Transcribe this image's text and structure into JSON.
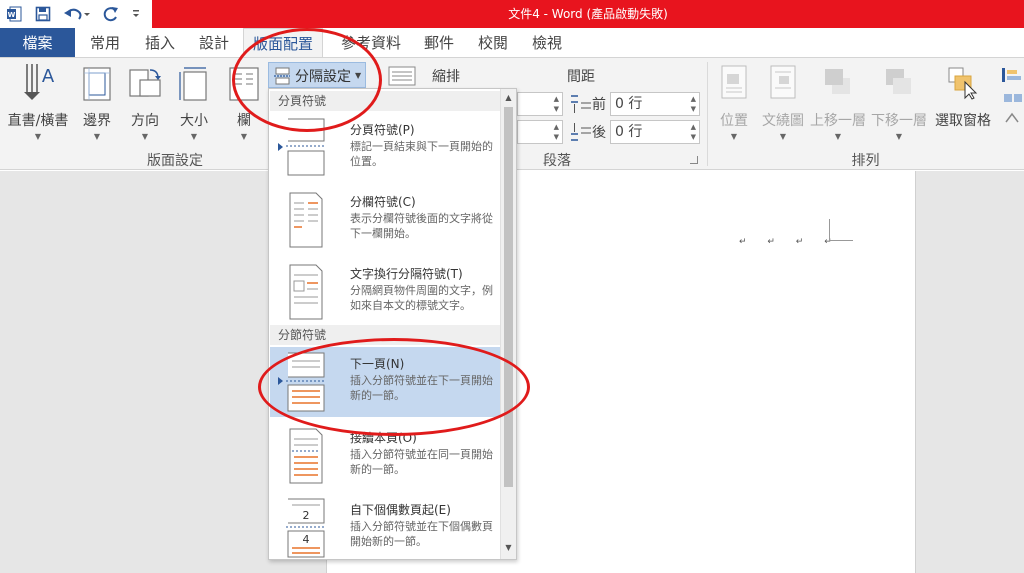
{
  "window": {
    "title": "文件4 - Word (產品啟動失敗)",
    "title_bar_color": "#e8141e",
    "accent_color": "#2b579a"
  },
  "quick_access": {
    "icons": [
      "word-logo-icon",
      "save-icon",
      "undo-icon",
      "redo-icon",
      "customize-icon"
    ]
  },
  "tabs": [
    {
      "label": "檔案"
    },
    {
      "label": "常用"
    },
    {
      "label": "插入"
    },
    {
      "label": "設計"
    },
    {
      "label": "版面配置"
    },
    {
      "label": "參考資料"
    },
    {
      "label": "郵件"
    },
    {
      "label": "校閱"
    },
    {
      "label": "檢視"
    }
  ],
  "ribbon": {
    "page_setup": {
      "buttons": [
        {
          "label": "直書/橫書",
          "icon": "text-direction-icon"
        },
        {
          "label": "邊界",
          "icon": "margins-icon"
        },
        {
          "label": "方向",
          "icon": "orientation-icon"
        },
        {
          "label": "大小",
          "icon": "size-icon"
        },
        {
          "label": "欄",
          "icon": "columns-icon"
        }
      ],
      "breaks_label": "分隔設定",
      "group_label": "版面設定"
    },
    "paragraph": {
      "indent_label": "縮排",
      "spacing_label": "間距",
      "before_label": "前",
      "after_label": "後",
      "before_value": "0 行",
      "after_value": "0 行",
      "group_label": "段落"
    },
    "arrange": {
      "buttons": [
        {
          "label": "位置",
          "icon": "position-icon"
        },
        {
          "label": "文繞圖",
          "icon": "wrap-text-icon"
        },
        {
          "label": "上移一層",
          "icon": "bring-forward-icon"
        },
        {
          "label": "下移一層",
          "icon": "send-backward-icon"
        },
        {
          "label": "選取窗格",
          "icon": "selection-pane-icon"
        }
      ],
      "group_label": "排列"
    }
  },
  "dropdown": {
    "sections": [
      {
        "header": "分頁符號",
        "items": [
          {
            "title": "分頁符號(P)",
            "desc": "標記一頁結束與下一頁開始的位置。"
          },
          {
            "title": "分欄符號(C)",
            "desc": "表示分欄符號後面的文字將從下一欄開始。"
          },
          {
            "title": "文字換行分隔符號(T)",
            "desc": "分隔網頁物件周圍的文字，例如來自本文的標號文字。"
          }
        ]
      },
      {
        "header": "分節符號",
        "items": [
          {
            "title": "下一頁(N)",
            "desc": "插入分節符號並在下一頁開始新的一節。"
          },
          {
            "title": "接續本頁(O)",
            "desc": "插入分節符號並在同一頁開始新的一節。"
          },
          {
            "title": "自下個偶數頁起(E)",
            "desc": "插入分節符號並在下個偶數頁開始新的一節。"
          }
        ]
      }
    ],
    "icon_numbers": [
      "2",
      "4"
    ]
  },
  "document": {
    "paragraph_marks": "↵ ↵ ↵ ↵"
  },
  "annotations": {
    "color": "#e01b1b"
  }
}
